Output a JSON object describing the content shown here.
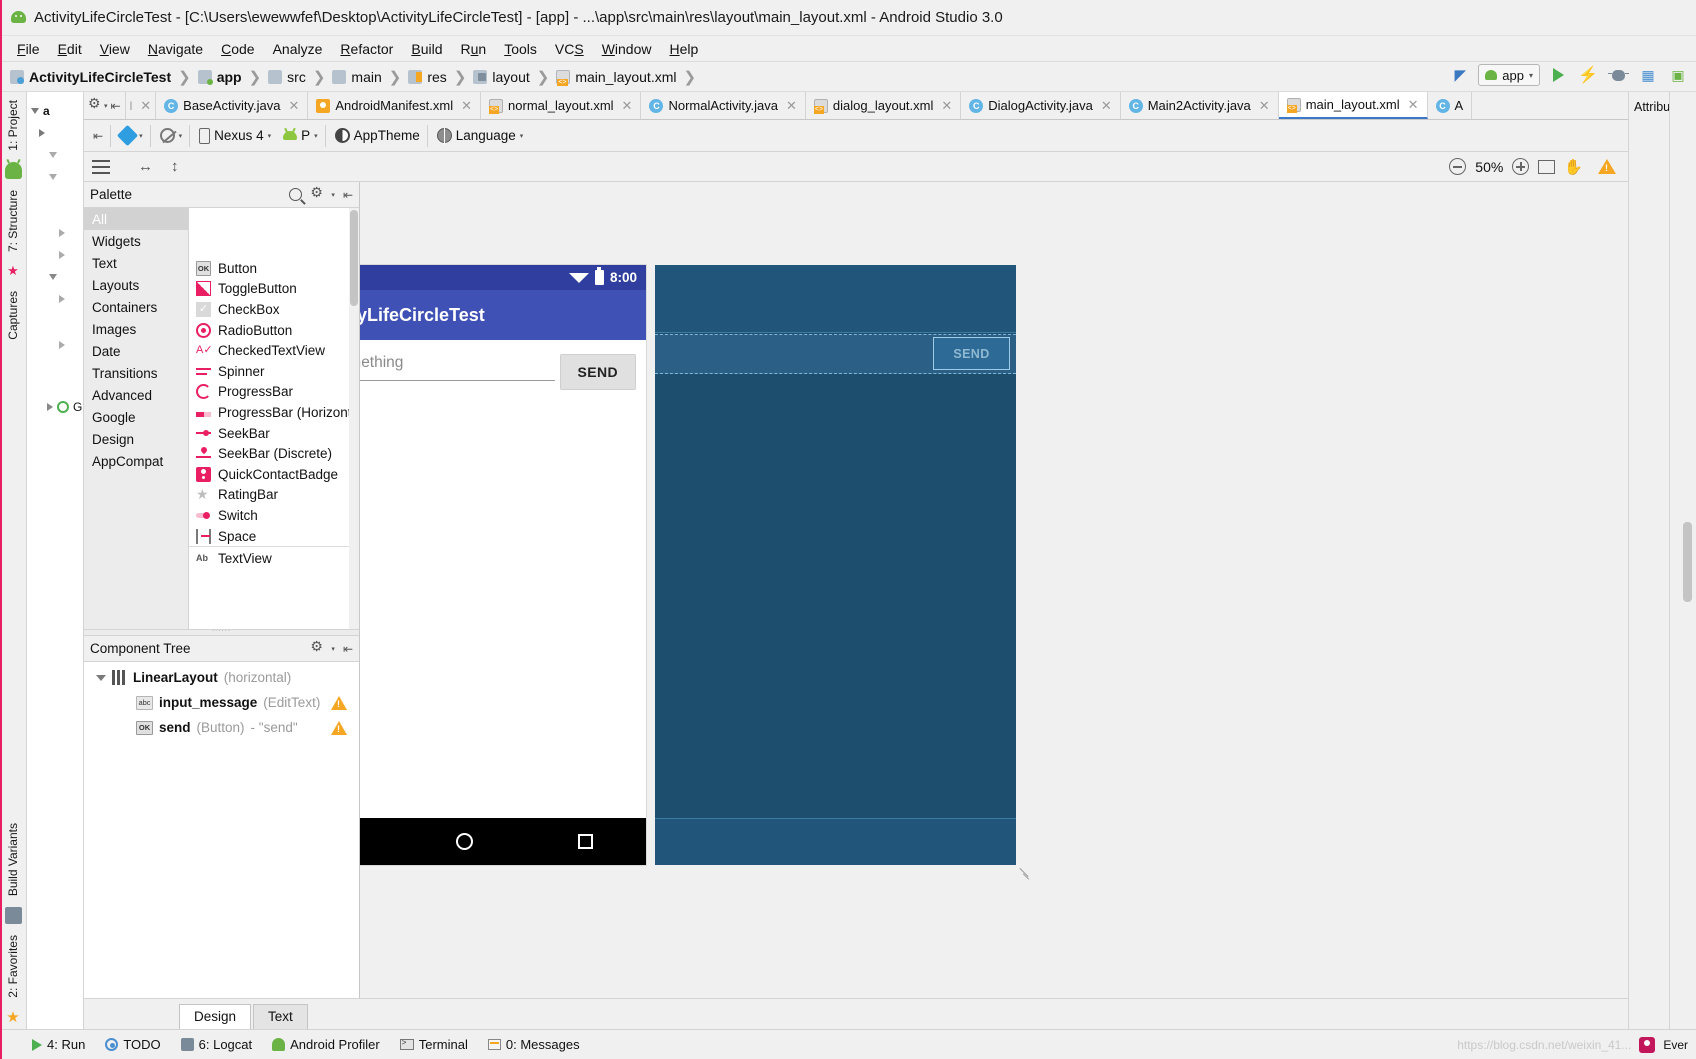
{
  "window": {
    "title": "ActivityLifeCircleTest - [C:\\Users\\ewewwfef\\Desktop\\ActivityLifeCircleTest] - [app] - ...\\app\\src\\main\\res\\layout\\main_layout.xml - Android Studio 3.0",
    "logo_icon": "android-studio-logo-icon"
  },
  "menubar": {
    "items": [
      {
        "label": "File"
      },
      {
        "label": "Edit"
      },
      {
        "label": "View"
      },
      {
        "label": "Navigate"
      },
      {
        "label": "Code"
      },
      {
        "label": "Analyze"
      },
      {
        "label": "Refactor"
      },
      {
        "label": "Build"
      },
      {
        "label": "Run"
      },
      {
        "label": "Tools"
      },
      {
        "label": "VCS"
      },
      {
        "label": "Window"
      },
      {
        "label": "Help"
      }
    ]
  },
  "breadcrumb": {
    "items": [
      {
        "label": "ActivityLifeCircleTest",
        "icon": "project-icon",
        "bold": true
      },
      {
        "label": "app",
        "icon": "module-icon",
        "bold": true
      },
      {
        "label": "src",
        "icon": "folder-icon",
        "bold": false
      },
      {
        "label": "main",
        "icon": "folder-icon",
        "bold": false
      },
      {
        "label": "res",
        "icon": "res-folder-icon",
        "bold": false
      },
      {
        "label": "layout",
        "icon": "layout-folder-icon",
        "bold": false
      },
      {
        "label": "main_layout.xml",
        "icon": "xml-file-icon",
        "bold": false
      }
    ],
    "separator": "❯"
  },
  "run_toolbar": {
    "config_label": "app",
    "caret": "▾",
    "buttons": [
      {
        "name": "run-button",
        "icon": "play-icon"
      },
      {
        "name": "apply-changes-button",
        "icon": "bolt-icon"
      },
      {
        "name": "debug-button",
        "icon": "bug-icon"
      },
      {
        "name": "profiler-button",
        "icon": "profiler-icon"
      },
      {
        "name": "avd-manager-button",
        "icon": "avd-icon"
      }
    ]
  },
  "left_strip": {
    "tabs": [
      {
        "label": "1: Project"
      },
      {
        "label": "7: Structure"
      },
      {
        "label": "Captures"
      },
      {
        "label": "Build Variants"
      },
      {
        "label": "2: Favorites"
      }
    ]
  },
  "editor_tabs": {
    "tabs": [
      {
        "label": "BaseActivity.java",
        "icon": "java-file-icon",
        "active": false
      },
      {
        "label": "AndroidManifest.xml",
        "icon": "manifest-file-icon",
        "active": false
      },
      {
        "label": "normal_layout.xml",
        "icon": "xml-file-icon",
        "active": false
      },
      {
        "label": "NormalActivity.java",
        "icon": "java-file-icon",
        "active": false
      },
      {
        "label": "dialog_layout.xml",
        "icon": "xml-file-icon",
        "active": false
      },
      {
        "label": "DialogActivity.java",
        "icon": "java-file-icon",
        "active": false
      },
      {
        "label": "Main2Activity.java",
        "icon": "java-file-icon",
        "active": false
      },
      {
        "label": "main_layout.xml",
        "icon": "xml-file-icon",
        "active": true
      },
      {
        "label": "A",
        "icon": "java-file-icon",
        "active": false
      }
    ],
    "close_glyph": "✕"
  },
  "designer_toolbar": {
    "design_mode_label": "",
    "device_label": "Nexus 4",
    "api_label": "P",
    "theme_label": "AppTheme",
    "language_label": "Language",
    "caret": "▾"
  },
  "designer_toolbar2": {
    "zoom_level": "50%",
    "zoom_out_icon": "zoom-out-icon",
    "zoom_in_icon": "zoom-in-icon",
    "zoom_fit_icon": "zoom-to-fit-icon",
    "pan_icon": "pan-hand-icon",
    "warning_icon": "warning-triangle-icon",
    "menu_icon": "hamburger-menu-icon"
  },
  "palette": {
    "title": "Palette",
    "search_icon": "search-icon",
    "gear_icon": "gear-icon",
    "categories": [
      {
        "label": "All",
        "selected": true
      },
      {
        "label": "Widgets",
        "selected": false
      },
      {
        "label": "Text",
        "selected": false
      },
      {
        "label": "Layouts",
        "selected": false
      },
      {
        "label": "Containers",
        "selected": false
      },
      {
        "label": "Images",
        "selected": false
      },
      {
        "label": "Date",
        "selected": false
      },
      {
        "label": "Transitions",
        "selected": false
      },
      {
        "label": "Advanced",
        "selected": false
      },
      {
        "label": "Google",
        "selected": false
      },
      {
        "label": "Design",
        "selected": false
      },
      {
        "label": "AppCompat",
        "selected": false
      }
    ],
    "items": [
      {
        "label": "Button",
        "icon": "button-icon"
      },
      {
        "label": "ToggleButton",
        "icon": "togglebutton-icon"
      },
      {
        "label": "CheckBox",
        "icon": "checkbox-icon"
      },
      {
        "label": "RadioButton",
        "icon": "radiobutton-icon"
      },
      {
        "label": "CheckedTextView",
        "icon": "checkedtextview-icon"
      },
      {
        "label": "Spinner",
        "icon": "spinner-icon"
      },
      {
        "label": "ProgressBar",
        "icon": "progressbar-icon"
      },
      {
        "label": "ProgressBar (Horizontal)",
        "icon": "progressbar-horizontal-icon"
      },
      {
        "label": "SeekBar",
        "icon": "seekbar-icon"
      },
      {
        "label": "SeekBar (Discrete)",
        "icon": "seekbar-discrete-icon"
      },
      {
        "label": "QuickContactBadge",
        "icon": "quickcontactbadge-icon"
      },
      {
        "label": "RatingBar",
        "icon": "ratingbar-icon"
      },
      {
        "label": "Switch",
        "icon": "switch-icon"
      },
      {
        "label": "Space",
        "icon": "space-icon"
      },
      {
        "label": "TextView",
        "icon": "textview-icon"
      }
    ]
  },
  "component_tree": {
    "title": "Component Tree",
    "gear_icon": "gear-icon",
    "collapse_icon": "collapse-all-icon",
    "nodes": [
      {
        "name": "LinearLayout",
        "detail": "(horizontal)",
        "value": "",
        "icon": "linearlayout-icon",
        "warning": false,
        "level": 0
      },
      {
        "name": "input_message",
        "detail": "(EditText)",
        "value": "",
        "icon": "edittext-icon",
        "warning": true,
        "level": 1
      },
      {
        "name": "send",
        "detail": "(Button)",
        "value": " - \"send\"",
        "icon": "button-icon",
        "warning": true,
        "level": 1
      }
    ]
  },
  "preview": {
    "status_time": "8:00",
    "wifi_icon": "wifi-icon",
    "battery_icon": "battery-icon",
    "app_title": "ActivityLifeCircleTest",
    "edittext_hint": "Type something",
    "send_button_label": "SEND",
    "nav_back_icon": "nav-back-icon",
    "nav_home_icon": "nav-home-icon",
    "nav_recents_icon": "nav-recents-icon"
  },
  "blueprint": {
    "send_button_label": "SEND",
    "resize_handle_icon": "resize-handle-icon"
  },
  "attributes_panel": {
    "title": "Attributes"
  },
  "design_tabs": {
    "tabs": [
      {
        "label": "Design",
        "active": true
      },
      {
        "label": "Text",
        "active": false
      }
    ]
  },
  "statusbar": {
    "items": [
      {
        "label": "4: Run",
        "icon": "run-icon"
      },
      {
        "label": "TODO",
        "icon": "todo-icon"
      },
      {
        "label": "6: Logcat",
        "icon": "logcat-icon"
      },
      {
        "label": "Android Profiler",
        "icon": "profiler-icon"
      },
      {
        "label": "Terminal",
        "icon": "terminal-icon"
      },
      {
        "label": "0: Messages",
        "icon": "messages-icon"
      }
    ],
    "watermark": "https://blog.csdn.net/weixin_41...",
    "right_label": "Ever",
    "avatar_icon": "avatar-icon"
  },
  "colors": {
    "accent_pink": "#e91e63",
    "appbar_blue": "#3f51b5",
    "statusbar_blue": "#303f9f",
    "blueprint_bg": "#1d4e6e",
    "warning_orange": "#f5a623"
  }
}
